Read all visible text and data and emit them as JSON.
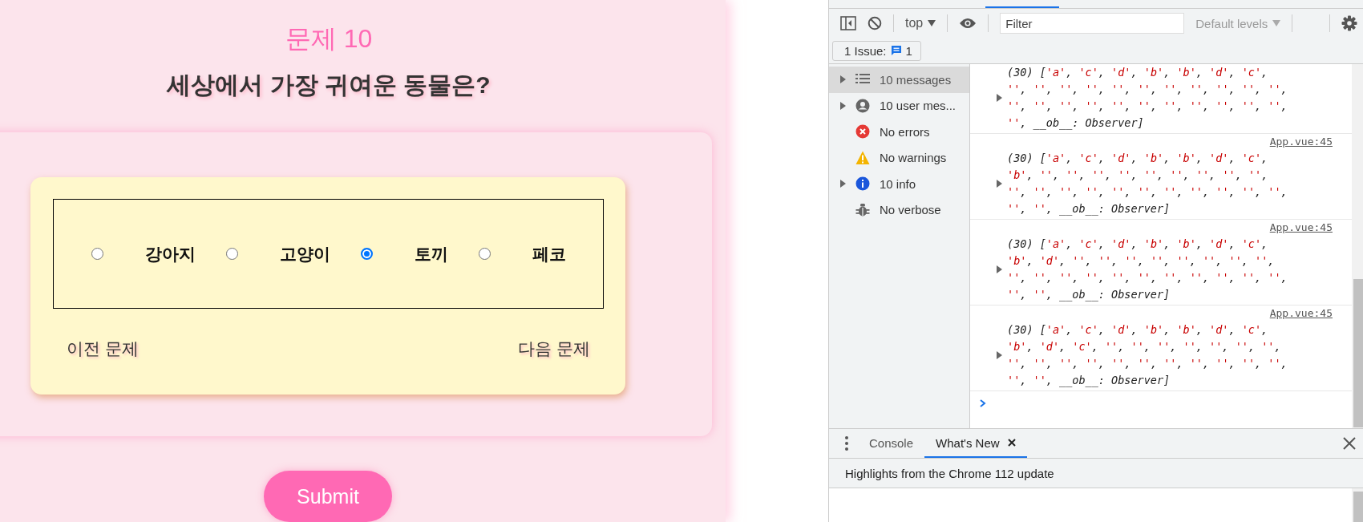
{
  "quiz": {
    "heading": "문제 10",
    "question": "세상에서 가장 귀여운 동물은?",
    "options": [
      {
        "label": "강아지",
        "selected": false
      },
      {
        "label": "고양이",
        "selected": false
      },
      {
        "label": "토끼",
        "selected": true
      },
      {
        "label": "페코",
        "selected": false
      }
    ],
    "prev": "이전 문제",
    "next": "다음 문제",
    "submit": "Submit"
  },
  "devtools": {
    "toolbar": {
      "context": "top",
      "filter_placeholder": "Filter",
      "levels": "Default levels"
    },
    "issues": {
      "label": "1 Issue:",
      "count": "1"
    },
    "sidebar": [
      {
        "label": "10 messages",
        "kind": "list",
        "expandable": true,
        "selected": true
      },
      {
        "label": "10 user mes...",
        "kind": "user",
        "expandable": true,
        "selected": false
      },
      {
        "label": "No errors",
        "kind": "error",
        "expandable": false,
        "selected": false
      },
      {
        "label": "No warnings",
        "kind": "warning",
        "expandable": false,
        "selected": false
      },
      {
        "label": "10 info",
        "kind": "info",
        "expandable": true,
        "selected": false
      },
      {
        "label": "No verbose",
        "kind": "verbose",
        "expandable": false,
        "selected": false
      }
    ],
    "logs": [
      {
        "lines": [
          "(30) ['a', 'c', 'd', 'b', 'b', 'd', 'c',",
          "'', '', '', '', '', '', '', '', '', '', '',",
          "'', '', '', '', '', '', '', '', '', '', '',",
          "'', __ob__: Observer]"
        ]
      },
      {
        "source": "App.vue:45",
        "lines": [
          "(30) ['a', 'c', 'd', 'b', 'b', 'd', 'c',",
          "'b', '', '', '', '', '', '', '', '', '',",
          "'', '', '', '', '', '', '', '', '', '', '',",
          "'', '', __ob__: Observer]"
        ]
      },
      {
        "source": "App.vue:45",
        "lines": [
          "(30) ['a', 'c', 'd', 'b', 'b', 'd', 'c',",
          "'b', 'd', '', '', '', '', '', '', '', '',",
          "'', '', '', '', '', '', '', '', '', '', '',",
          "'', '', __ob__: Observer]"
        ]
      },
      {
        "source": "App.vue:45",
        "lines": [
          "(30) ['a', 'c', 'd', 'b', 'b', 'd', 'c',",
          "'b', 'd', 'c', '', '', '', '', '', '', '',",
          "'', '', '', '', '', '', '', '', '', '', '',",
          "'', '', __ob__: Observer]"
        ]
      }
    ],
    "drawer": {
      "tabs": [
        {
          "label": "Console",
          "selected": false,
          "closable": false
        },
        {
          "label": "What's New",
          "selected": true,
          "closable": true
        }
      ],
      "highlights": "Highlights from the Chrome 112 update"
    }
  }
}
